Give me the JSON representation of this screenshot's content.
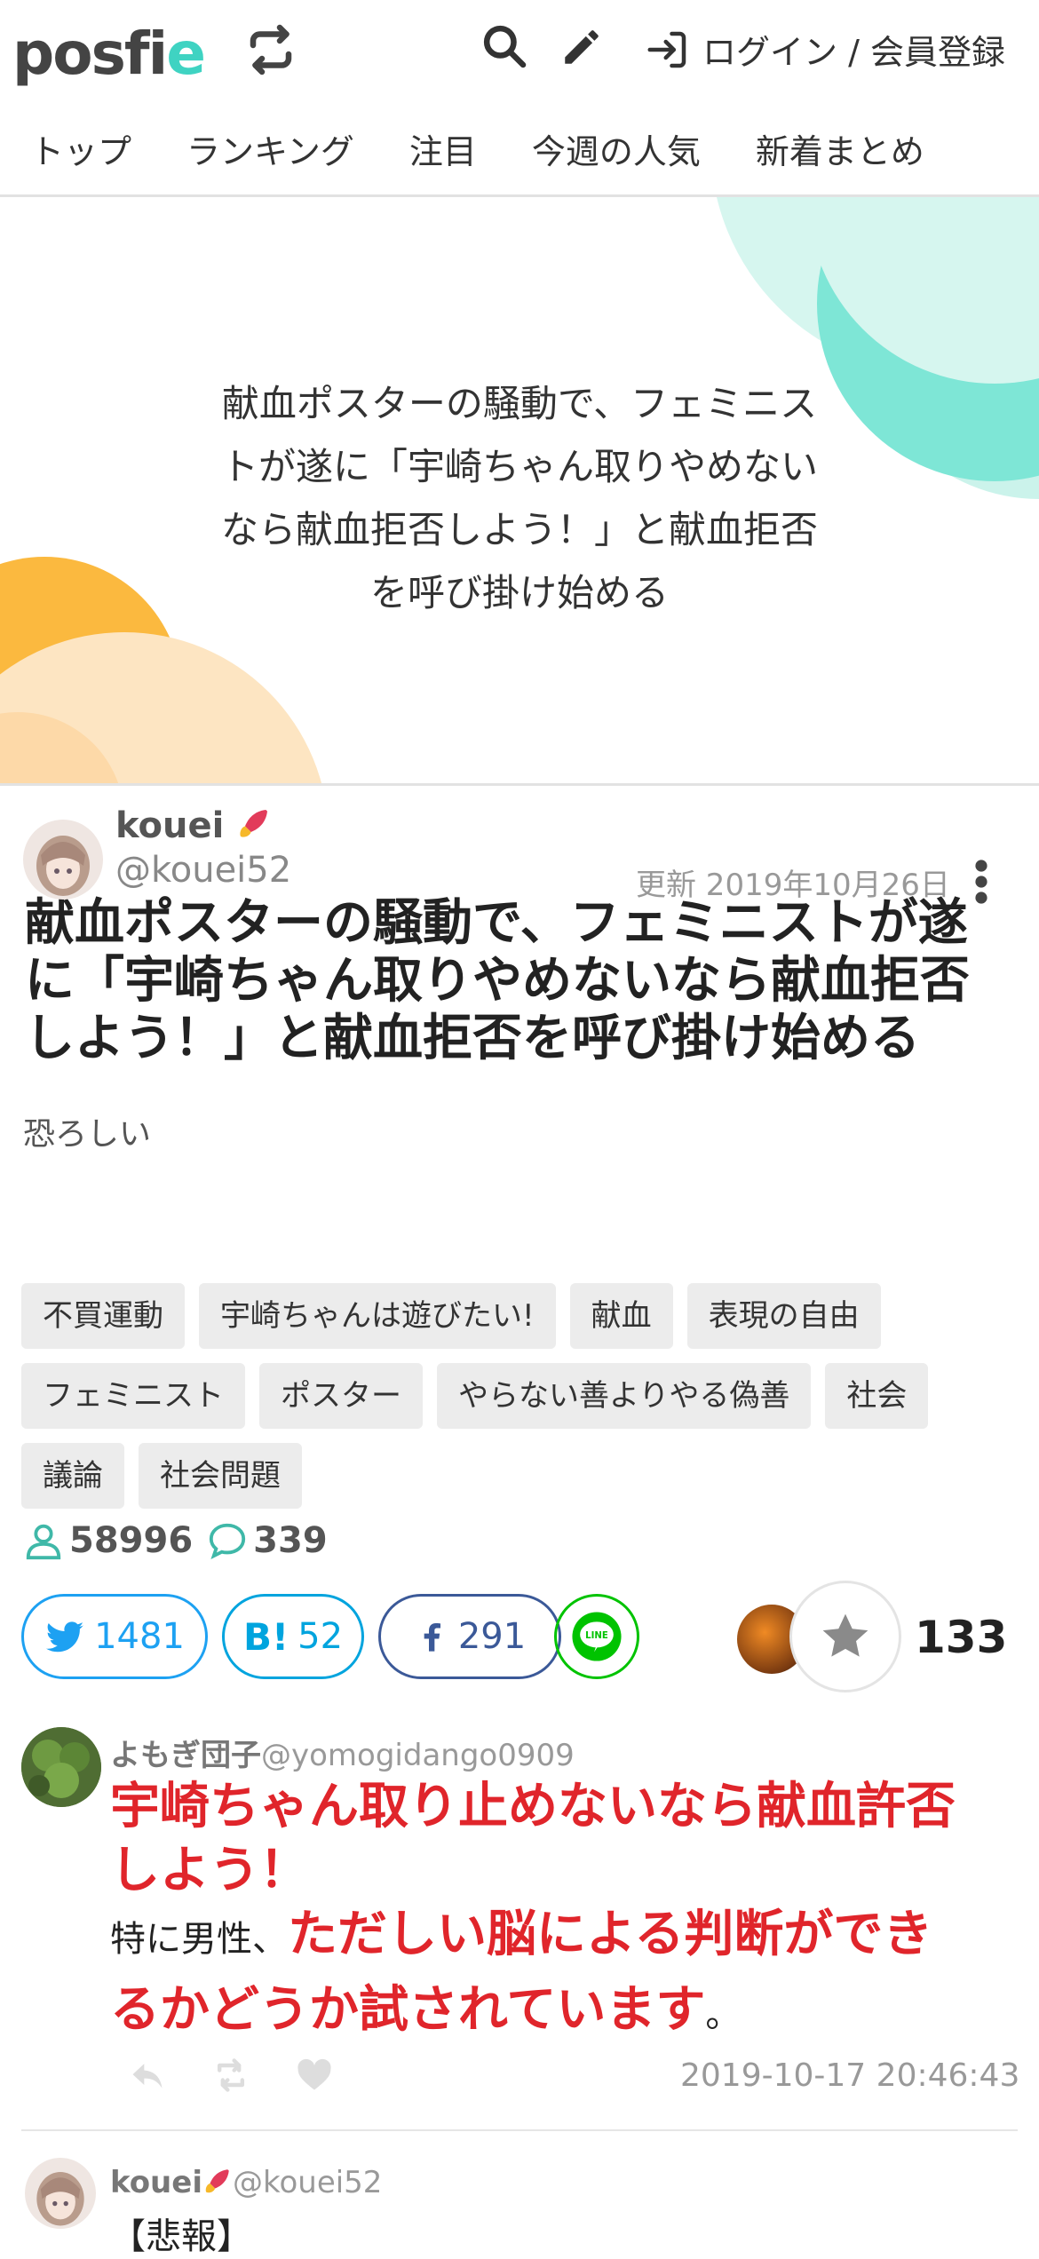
{
  "header": {
    "logo_main": "posfi",
    "logo_accent": "e",
    "login_label": "ログイン / 会員登録"
  },
  "nav": {
    "items": [
      "トップ",
      "ランキング",
      "注目",
      "今週の人気",
      "新着まとめ"
    ]
  },
  "hero": {
    "title_lines": [
      "献血ポスターの騒動で、フェミニス",
      "トが遂に「宇崎ちゃん取りやめない",
      "なら献血拒否しよう！」と献血拒否",
      "を呼び掛け始める"
    ]
  },
  "author": {
    "name": "kouei",
    "handle": "@kouei52",
    "updated": "更新 2019年10月26日"
  },
  "post": {
    "title_lines": [
      "献血ポスターの騒動で、フェミニストが遂",
      "に「宇崎ちゃん取りやめないなら献血拒否",
      "しよう！」と献血拒否を呼び掛け始める"
    ],
    "subtitle": "恐ろしい"
  },
  "tags": [
    "不買運動",
    "宇崎ちゃんは遊びたい!",
    "献血",
    "表現の自由",
    "フェミニスト",
    "ポスター",
    "やらない善よりやる偽善",
    "社会",
    "議論",
    "社会問題"
  ],
  "stats": {
    "views": "58996",
    "comments": "339"
  },
  "share": {
    "twitter_count": "1481",
    "hatena_label": "B!",
    "hatena_count": "52",
    "facebook_count": "291",
    "line_label": "LINE",
    "favorites": "133"
  },
  "colors": {
    "accent": "#3fd3c2",
    "twitter": "#1da1f2",
    "hatena": "#00a4de",
    "facebook": "#3b5998",
    "line": "#00c300",
    "highlight_red": "#e0252b"
  },
  "tweet1": {
    "display_name": "よもぎ団子",
    "handle": "@yomogidango0909",
    "line1": "宇崎ちゃん取り止めないなら献血許否",
    "line2": "しよう！",
    "line3_normal": "特に男性、",
    "line3_red": "ただしい脳による判断ができ",
    "line4_red": "るかどうか試されています",
    "line4_end": "。",
    "timestamp": "2019-10-17 20:46:43"
  },
  "tweet2": {
    "display_name": "kouei",
    "handle": "@kouei52",
    "text": "【悲報】"
  }
}
